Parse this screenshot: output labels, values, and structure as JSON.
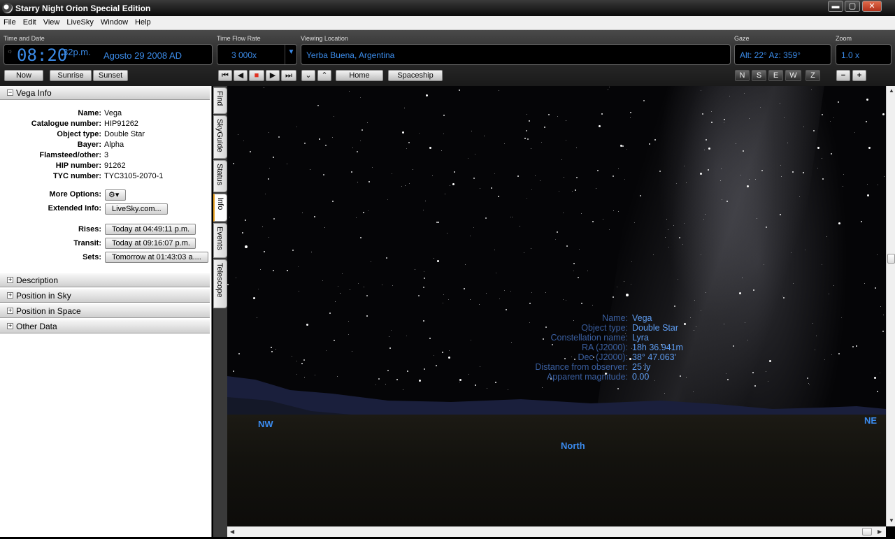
{
  "window": {
    "title": "Starry Night Orion Special Edition",
    "minimize": "▬",
    "maximize": "▢",
    "close": "✕"
  },
  "menu": [
    "File",
    "Edit",
    "View",
    "LiveSky",
    "Window",
    "Help"
  ],
  "toolbar": {
    "time_date_label": "Time and Date",
    "time": "08:20",
    "ampm": "32p.m.",
    "date": "Agosto 29 2008 AD",
    "now": "Now",
    "sunrise": "Sunrise",
    "sunset": "Sunset",
    "flow_label": "Time Flow Rate",
    "flow_value": "3 000x",
    "viewing_label": "Viewing Location",
    "location": "Yerba Buena, Argentina",
    "home": "Home",
    "spaceship": "Spaceship",
    "gaze_label": "Gaze",
    "gaze_value": "Alt: 22° Az: 359°",
    "gaze_buttons": [
      "N",
      "S",
      "E",
      "W",
      "Z"
    ],
    "zoom_label": "Zoom",
    "zoom_value": "1.0 x",
    "zoom_out": "−",
    "zoom_in": "+"
  },
  "panel": {
    "header": "Vega Info",
    "rows": [
      {
        "k": "Name:",
        "v": "Vega"
      },
      {
        "k": "Catalogue number:",
        "v": "HIP91262"
      },
      {
        "k": "Object type:",
        "v": "Double Star"
      },
      {
        "k": "Bayer:",
        "v": "Alpha"
      },
      {
        "k": "Flamsteed/other:",
        "v": "3"
      },
      {
        "k": "HIP number:",
        "v": "91262"
      },
      {
        "k": "TYC number:",
        "v": "TYC3105-2070-1"
      }
    ],
    "more_options_label": "More Options:",
    "more_options_btn": "⚙▾",
    "extended_label": "Extended Info:",
    "extended_btn": "LiveSky.com...",
    "rises_label": "Rises:",
    "rises": "Today at 04:49:11 p.m.",
    "transit_label": "Transit:",
    "transit": "Today at 09:16:07 p.m.",
    "sets_label": "Sets:",
    "sets": "Tomorrow at 01:43:03 a....",
    "sections": [
      "Description",
      "Position in Sky",
      "Position in Space",
      "Other Data"
    ]
  },
  "tabs": [
    "Find",
    "SkyGuide",
    "Status",
    "Info",
    "Events",
    "Telescope"
  ],
  "sky": {
    "compass": {
      "nw": "NW",
      "north": "North",
      "ne": "NE"
    },
    "object": [
      {
        "k": "Name:",
        "v": "Vega"
      },
      {
        "k": "Object type:",
        "v": "Double Star"
      },
      {
        "k": "Constellation name:",
        "v": "Lyra"
      },
      {
        "k": "RA (J2000):",
        "v": "18h 36.941m"
      },
      {
        "k": "Dec (J2000):",
        "v": "38° 47.063'"
      },
      {
        "k": "Distance from observer:",
        "v": "25 ly"
      },
      {
        "k": "Apparent magnitude:",
        "v": "0.00"
      }
    ]
  },
  "colors": {
    "accent": "#3b8be8",
    "compass": "#3b8cf0",
    "playback_stop": "#e03020"
  },
  "playback": [
    "⏮",
    "◀",
    "■",
    "▶",
    "⏭"
  ],
  "nav_arrows": [
    "⌄",
    "⌃"
  ]
}
